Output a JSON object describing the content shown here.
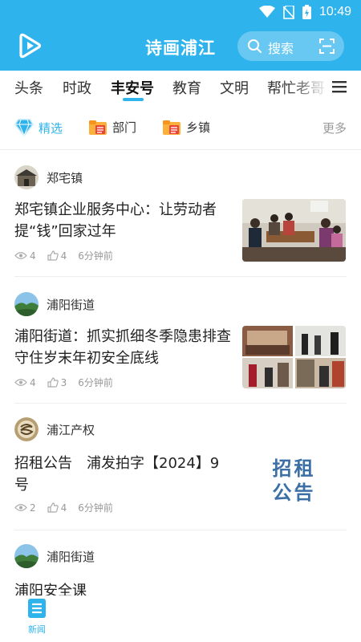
{
  "status_bar": {
    "time": "10:49",
    "icons": [
      "wifi-icon",
      "no-sim-icon",
      "battery-charging-icon"
    ]
  },
  "header": {
    "title": "诗画浦江",
    "search_label": "搜索",
    "accent_color": "#2fb3ec"
  },
  "tabs": [
    "头条",
    "时政",
    "丰安号",
    "教育",
    "文明",
    "帮忙老哥"
  ],
  "active_tab": "丰安号",
  "subnav": {
    "items": [
      {
        "label": "精选",
        "icon": "diamond-icon"
      },
      {
        "label": "部门",
        "icon": "folder-list-icon"
      },
      {
        "label": "乡镇",
        "icon": "folder-list-icon"
      }
    ],
    "more": "更多"
  },
  "articles": [
    {
      "source": "郑宅镇",
      "title": "郑宅镇企业服务中心：让劳动者提“钱”回家过年",
      "views": "4",
      "likes": "4",
      "time": "6分钟前"
    },
    {
      "source": "浦阳街道",
      "title": "浦阳街道：抓实抓细冬季隐患排查 守住岁末年初安全底线",
      "views": "4",
      "likes": "3",
      "time": "6分钟前"
    },
    {
      "source": "浦江产权",
      "title": "招租公告　浦发拍字【2024】9号",
      "views": "2",
      "likes": "4",
      "time": "6分钟前",
      "thumb_text": [
        "招租",
        "公告"
      ]
    },
    {
      "source": "浦阳街道",
      "title": "浦阳安全课"
    }
  ],
  "bottom_nav": {
    "news_label": "新闻"
  }
}
